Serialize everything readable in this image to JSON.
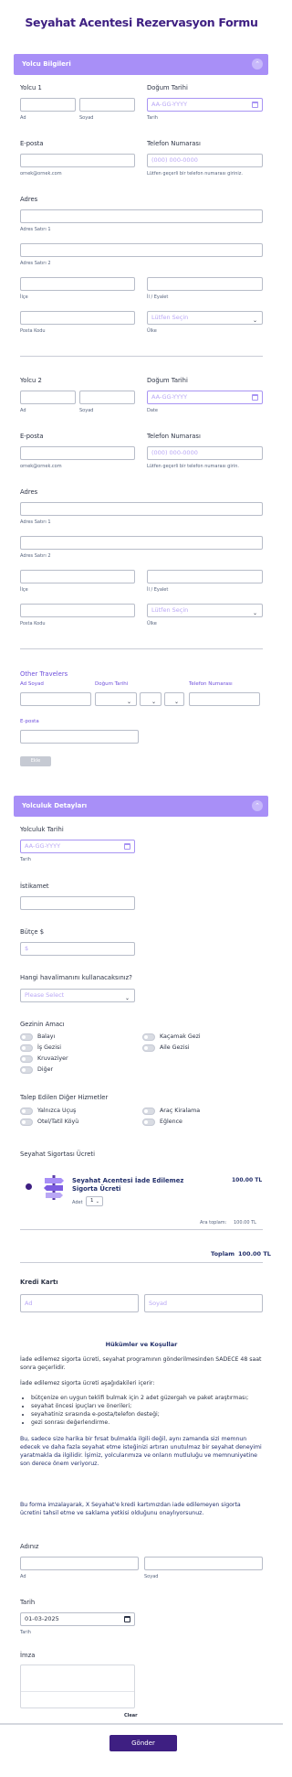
{
  "title": "Seyahat Acentesi Rezervasyon Formu",
  "sections": {
    "yolcu": "Yolcu Bilgileri",
    "yolculuk": "Yolculuk Detayları"
  },
  "traveler1": {
    "name_label": "Yolcu 1",
    "first_sub": "Ad",
    "last_sub": "Soyad",
    "dob_label": "Doğum Tarihi",
    "dob_placeholder": "AA-GG-YYYY",
    "dob_sub": "Tarih",
    "email_label": "E-posta",
    "email_sub": "ornek@ornek.com",
    "phone_label": "Telefon Numarası",
    "phone_placeholder": "(000) 000-0000",
    "phone_sub": "Lütfen geçerli bir telefon numarası giriniz.",
    "address_label": "Adres",
    "addr1_sub": "Adres Satırı 1",
    "addr2_sub": "Adres Satırı 2",
    "city_sub": "İlçe",
    "state_sub": "İl / Eyalet",
    "postal_sub": "Posta Kodu",
    "country_placeholder": "Lütfen Seçin",
    "country_sub": "Ülke"
  },
  "traveler2": {
    "name_label": "Yolcu 2",
    "first_sub": "Ad",
    "last_sub": "Soyad",
    "dob_label": "Doğum Tarihi",
    "dob_placeholder": "AA-GG-YYYY",
    "dob_sub": "Date",
    "email_label": "E-posta",
    "email_sub": "ornek@ornek.com",
    "phone_label": "Telefon Numarası",
    "phone_placeholder": "(000) 000-0000",
    "phone_sub": "Lütfen geçerli bir telefon numarası girin.",
    "address_label": "Adres",
    "addr1_sub": "Adres Satırı 1",
    "addr2_sub": "Adres Satırı 2",
    "city_sub": "İlçe",
    "state_sub": "İl / Eyalet",
    "postal_sub": "Posta Kodu",
    "country_placeholder": "Lütfen Seçin",
    "country_sub": "Ülke"
  },
  "other_travelers": {
    "title": "Other Travelers",
    "col_name": "Ad Soyad",
    "col_dob": "Doğum Tarihi",
    "col_phone": "Telefon Numarası",
    "col_email": "E-posta",
    "add_button": "Ekle"
  },
  "trip": {
    "date_label": "Yolculuk Tarihi",
    "date_placeholder": "AA-GG-YYYY",
    "date_sub": "Tarih",
    "destination_label": "İstikamet",
    "budget_label": "Bütçe $",
    "budget_value": "$",
    "airline_label": "Hangi havalimanını kullanacaksınız?",
    "airline_placeholder": "Please Select",
    "purpose_label": "Gezinin Amacı",
    "purpose_options": [
      "Balayı",
      "İş Gezisi",
      "Kruvaziyer",
      "Diğer",
      "Kaçamak Gezi",
      "Aile Gezisi"
    ],
    "services_label": "Talep Edilen Diğer Hizmetler",
    "services_options": [
      "Yalnızca Uçuş",
      "Otel/Tatil Köyü",
      "Araç Kiralama",
      "Eğlence"
    ],
    "insurance_label": "Seyahat Sigortası Ücreti",
    "product_name": "Seyahat Acentesi İade Edilemez Sigorta Ücreti",
    "product_price": "100.00 TL",
    "qty_label": "Adet",
    "qty_value": "1",
    "subtotal_label": "Ara toplam:",
    "subtotal_value": "100.00 TL",
    "total_label": "Toplam",
    "total_value": "100.00 TL"
  },
  "card": {
    "label": "Kredi Kartı",
    "first_placeholder": "Ad",
    "last_placeholder": "Soyad"
  },
  "terms": {
    "title": "Hükümler ve Koşullar",
    "p1": "İade edilemez sigorta ücreti, seyahat programının gönderilmesinden SADECE 48 saat sonra geçerlidir.",
    "p2": "İade edilemez sigorta ücreti aşağıdakileri içerir:",
    "bullets": [
      "bütçenize en uygun teklifi bulmak için 2 adet güzergah ve paket araştırması;",
      "seyahat öncesi ipuçları ve önerileri;",
      "seyahatiniz sırasında e-posta/telefon desteği;",
      "gezi sonrası değerlendirme."
    ],
    "p3": "Bu, sadece size harika bir fırsat bulmakla ilgili değil, aynı zamanda sizi memnun edecek ve daha fazla seyahat etme isteğinizi artıran unutulmaz bir seyahat deneyimi yaratmakla da ilgilidir. İşimiz, yolcularımıza ve onların mutluluğu ve memnuniyetine son derece önem veriyoruz.",
    "p4": "Bu forma imzalayarak, X Seyahat'e kredi kartımızdan iade edilemeyen sigorta ücretini tahsil etme ve saklama yetkisi olduğunu onaylıyorsunuz."
  },
  "signer": {
    "name_label": "Adınız",
    "first_sub": "Ad",
    "last_sub": "Soyad",
    "date_label": "Tarih",
    "date_value": "01-03-2025",
    "date_sub": "Tarih",
    "signature_label": "İmza",
    "clear_label": "Clear"
  },
  "submit_label": "Gönder"
}
